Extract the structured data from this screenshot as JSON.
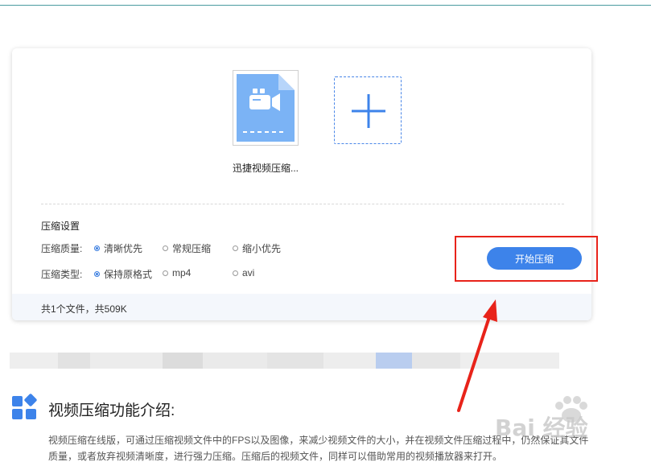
{
  "upload": {
    "file_name": "迅捷视频压缩...",
    "add_icon": "plus-icon",
    "file_icon": "video-file-icon"
  },
  "settings": {
    "title": "压缩设置",
    "quality": {
      "label": "压缩质量:",
      "options": [
        "清晰优先",
        "常规压缩",
        "缩小优先"
      ],
      "selected": "清晰优先"
    },
    "type": {
      "label": "压缩类型:",
      "options": [
        "保持原格式",
        "mp4",
        "avi"
      ],
      "selected": "保持原格式"
    },
    "start_label": "开始压缩"
  },
  "footer": {
    "summary": "共1个文件，共509K"
  },
  "intro": {
    "title": "视频压缩功能介绍:",
    "line1": "视频压缩在线版，可通过压缩视频文件中的FPS以及图像，来减少视频文件的大小，并在视频文件压缩过程中，仍然保证其文件",
    "line2": "质量，或者放弃视频清晰度，进行强力压缩。压缩后的视频文件，同样可以借助常用的视频播放器来打开。"
  },
  "annotation": {
    "highlight_color": "#e8231a",
    "arrow_color": "#e8231a"
  },
  "colors": {
    "accent": "#3d83ea",
    "file_icon": "#7bb3f5"
  },
  "watermark": {
    "text": "Bai 经验"
  }
}
